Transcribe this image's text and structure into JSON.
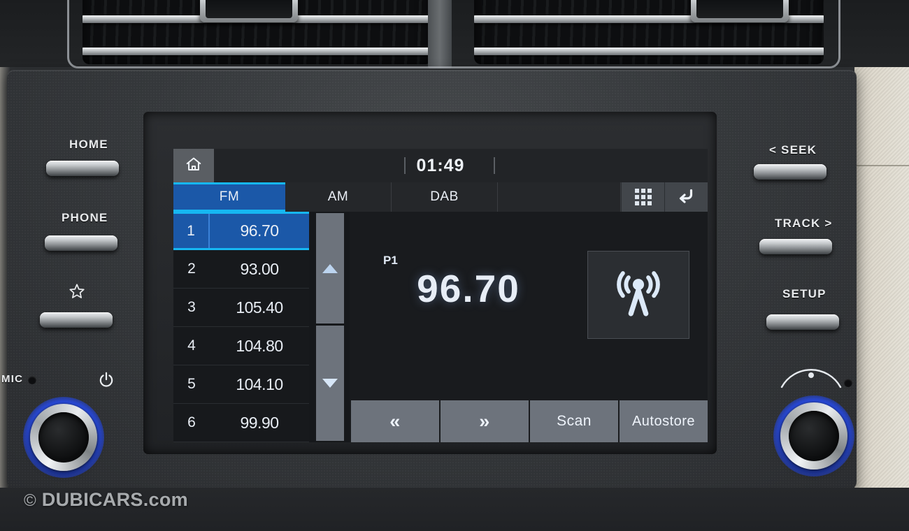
{
  "vehicle_ui": {
    "hardware": {
      "left_buttons": [
        {
          "label": "HOME",
          "name": "home-hard-button"
        },
        {
          "label": "PHONE",
          "name": "phone-hard-button"
        },
        {
          "label": "",
          "name": "favorite-hard-button",
          "icon": "star-icon"
        }
      ],
      "right_buttons": [
        {
          "label": "< SEEK",
          "name": "seek-hard-button"
        },
        {
          "label": "TRACK >",
          "name": "track-hard-button"
        },
        {
          "label": "SETUP",
          "name": "setup-hard-button"
        }
      ],
      "mic_label": "MIC",
      "power_icon": "power-icon",
      "volume_knob": "volume-knob",
      "tune_knob": "tune-knob"
    },
    "screen": {
      "status": {
        "home_icon": "home-icon",
        "clock": "01:49"
      },
      "tabs": [
        {
          "label": "FM",
          "active": true
        },
        {
          "label": "AM",
          "active": false
        },
        {
          "label": "DAB",
          "active": false
        }
      ],
      "toolbar_icons": [
        {
          "name": "keypad-grid-icon"
        },
        {
          "name": "back-arrow-icon"
        }
      ],
      "presets": [
        {
          "number": "1",
          "frequency": "96.70",
          "active": true
        },
        {
          "number": "2",
          "frequency": "93.00",
          "active": false
        },
        {
          "number": "3",
          "frequency": "105.40",
          "active": false
        },
        {
          "number": "4",
          "frequency": "104.80",
          "active": false
        },
        {
          "number": "5",
          "frequency": "104.10",
          "active": false
        },
        {
          "number": "6",
          "frequency": "99.90",
          "active": false
        }
      ],
      "scroll": {
        "up": "scroll-up-button",
        "down": "scroll-down-button"
      },
      "now_playing": {
        "preset_label": "P1",
        "frequency": "96.70",
        "band": "FM",
        "station_icon": "radio-tower-icon"
      },
      "controls": [
        {
          "label": "«",
          "name": "tune-down-button"
        },
        {
          "label": "»",
          "name": "tune-up-button"
        },
        {
          "label": "Scan",
          "name": "scan-button"
        },
        {
          "label": "Autostore",
          "name": "autostore-button"
        }
      ]
    },
    "watermark": {
      "copyright": "©",
      "text": "DUBICARS.com"
    },
    "colors": {
      "accent_blue": "#1b58a8",
      "highlight_cyan": "#16b7f2",
      "button_grey": "#6d737c",
      "screen_bg": "#16181b"
    }
  }
}
